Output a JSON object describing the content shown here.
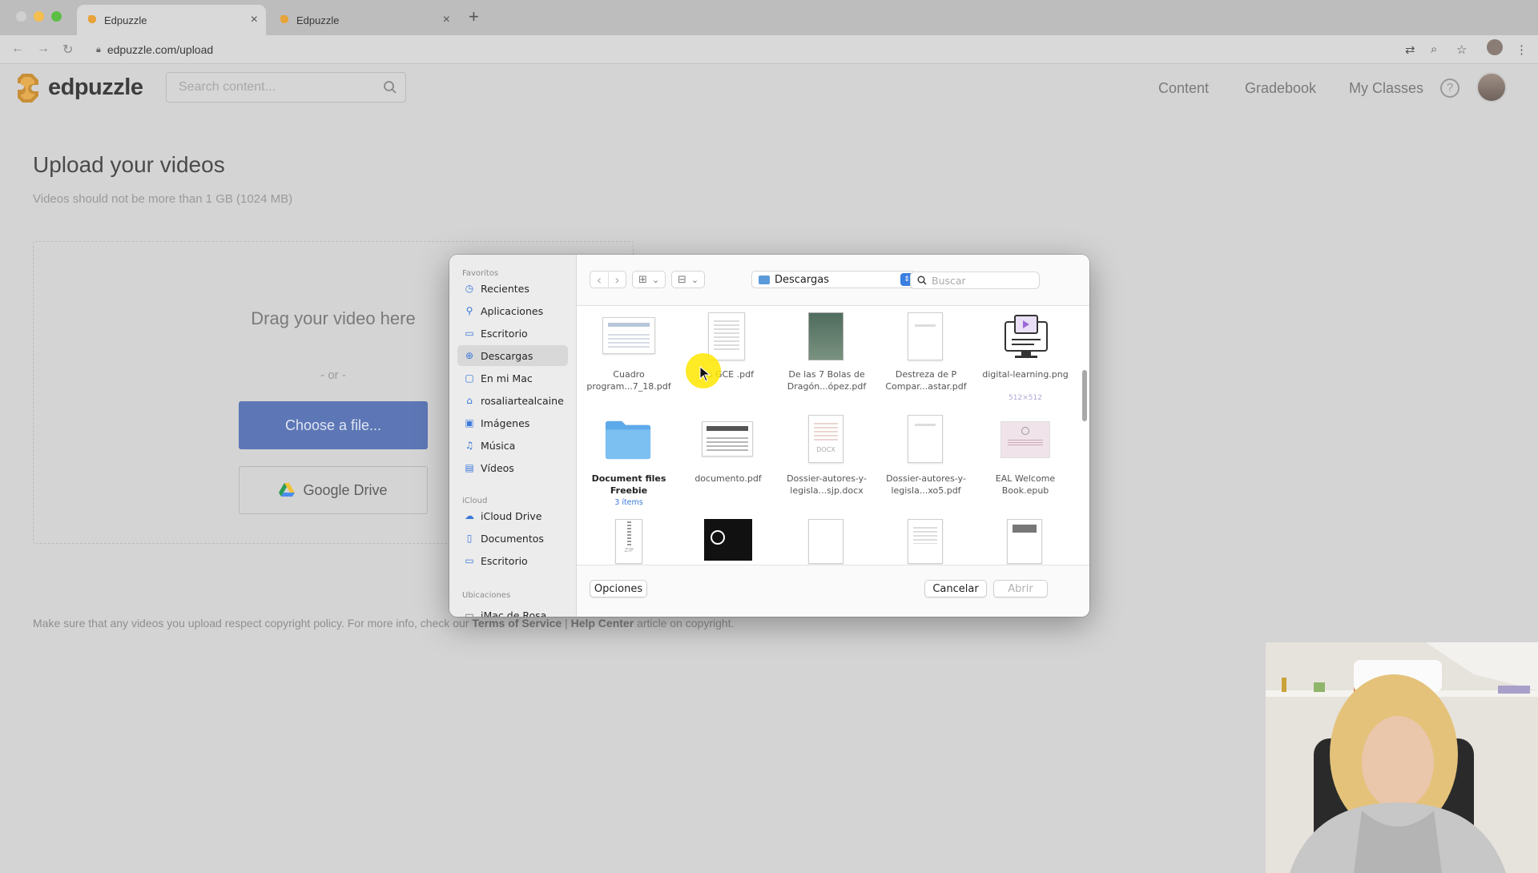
{
  "browser": {
    "tabs": [
      {
        "title": "Edpuzzle",
        "active": true
      },
      {
        "title": "Edpuzzle",
        "active": false
      }
    ],
    "url": "edpuzzle.com/upload",
    "new_tab": "+"
  },
  "header": {
    "logo_text": "edpuzzle",
    "search_placeholder": "Search content...",
    "nav": [
      "Content",
      "Gradebook",
      "My Classes"
    ],
    "help_label": "?"
  },
  "page": {
    "title": "Upload your videos",
    "subtitle": "Videos should not be more than 1 GB (1024 MB)",
    "drag_text": "Drag your video here",
    "or_text": "- or -",
    "choose_button": "Choose a file...",
    "gdrive_button": "Google Drive",
    "copyright_prefix": "Make sure that any videos you upload respect copyright policy. For more info, check our ",
    "terms_link": "Terms of Service",
    "separator": " | ",
    "help_center_link": "Help Center",
    "copyright_suffix": " article on copyright."
  },
  "dialog": {
    "sidebar": {
      "favorites_label": "Favoritos",
      "favorites": [
        {
          "label": "Recientes",
          "icon": "clock-icon"
        },
        {
          "label": "Aplicaciones",
          "icon": "apps-icon"
        },
        {
          "label": "Escritorio",
          "icon": "desktop-icon"
        },
        {
          "label": "Descargas",
          "icon": "download-icon",
          "selected": true
        },
        {
          "label": "En mi Mac",
          "icon": "folder-icon"
        },
        {
          "label": "rosaliartealcaine",
          "icon": "home-icon"
        },
        {
          "label": "Imágenes",
          "icon": "image-icon"
        },
        {
          "label": "Música",
          "icon": "music-icon"
        },
        {
          "label": "Vídeos",
          "icon": "film-icon"
        }
      ],
      "icloud_label": "iCloud",
      "icloud": [
        {
          "label": "iCloud Drive",
          "icon": "cloud-icon"
        },
        {
          "label": "Documentos",
          "icon": "document-icon"
        },
        {
          "label": "Escritorio",
          "icon": "desktop-icon"
        }
      ],
      "locations_label": "Ubicaciones",
      "locations": [
        {
          "label": "iMac de Rosa",
          "icon": "computer-icon"
        }
      ]
    },
    "toolbar": {
      "back": "‹",
      "forward": "›",
      "view_icon": "⊞",
      "group_icon": "⊟",
      "chevron": "⌄",
      "folder": "Descargas",
      "search_placeholder": "Buscar"
    },
    "files": [
      {
        "name": "Cuadro program...7_18.pdf",
        "type": "pdf"
      },
      {
        "name": "os GCE .pdf",
        "type": "pdf"
      },
      {
        "name": "De las 7 Bolas de Dragón...ópez.pdf",
        "type": "pdf"
      },
      {
        "name": "Destreza de P Compar...astar.pdf",
        "type": "pdf"
      },
      {
        "name": "digital-learning.png",
        "type": "png",
        "dim": "512×512"
      },
      {
        "name": "Document files Freebie",
        "type": "folder",
        "meta": "3 ítems"
      },
      {
        "name": "documento.pdf",
        "type": "pdf"
      },
      {
        "name": "Dossier-autores-y-legisla...sjp.docx",
        "type": "docx"
      },
      {
        "name": "Dossier-autores-y-legisla...xo5.pdf",
        "type": "pdf"
      },
      {
        "name": "EAL Welcome Book.epub",
        "type": "epub"
      },
      {
        "name": "",
        "type": "zip"
      },
      {
        "name": "",
        "type": "image"
      },
      {
        "name": "",
        "type": "blank"
      },
      {
        "name": "",
        "type": "docx"
      },
      {
        "name": "",
        "type": "docx"
      }
    ],
    "options_button": "Opciones",
    "cancel_button": "Cancelar",
    "open_button": "Abrir"
  },
  "colors": {
    "accent": "#3b78d8",
    "choose_button": "#5d77b6",
    "cursor_highlight": "#ffe600"
  }
}
